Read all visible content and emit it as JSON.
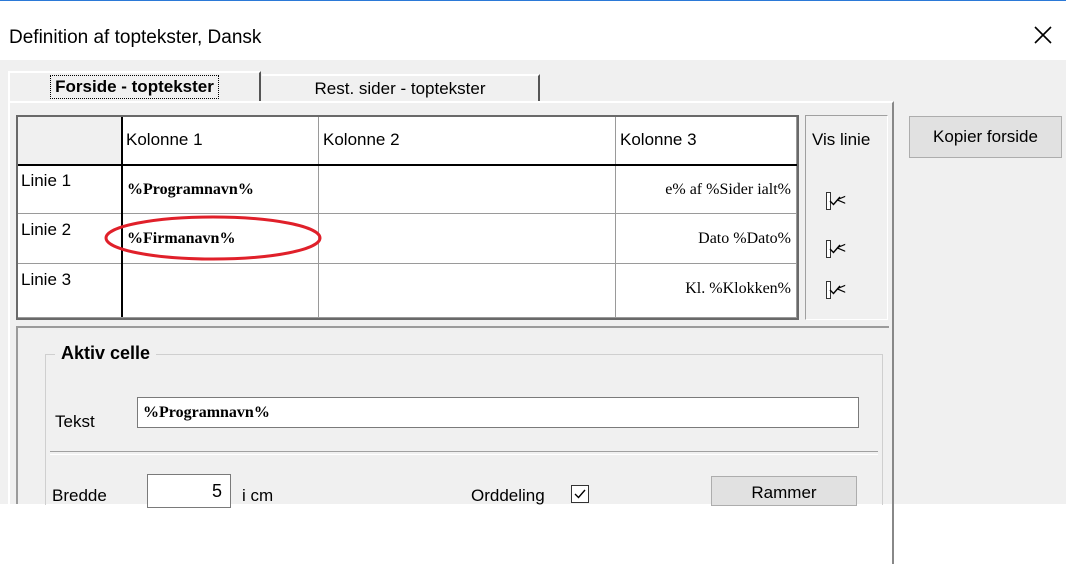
{
  "window": {
    "title": "Definition af toptekster, Dansk"
  },
  "tabs": [
    {
      "label": "Forside - toptekster",
      "active": true
    },
    {
      "label": "Rest. sider - toptekster",
      "active": false
    }
  ],
  "grid": {
    "columns": [
      "Kolonne 1",
      "Kolonne 2",
      "Kolonne 3"
    ],
    "rows": [
      {
        "label": "Linie 1",
        "cells": [
          "%Programnavn%",
          "",
          "e% af  %Sider ialt%"
        ]
      },
      {
        "label": "Linie 2",
        "cells": [
          "%Firmanavn%",
          "",
          "Dato %Dato%"
        ]
      },
      {
        "label": "Linie 3",
        "cells": [
          "",
          "",
          "Kl. %Klokken%"
        ]
      }
    ]
  },
  "vis_linie": {
    "label": "Vis linie",
    "checks": [
      {
        "checked": true,
        "suffix": "<"
      },
      {
        "checked": true,
        "suffix": "<"
      },
      {
        "checked": true,
        "suffix": "<"
      }
    ]
  },
  "buttons": {
    "kopier_forside": "Kopier forside",
    "rammer": "Rammer"
  },
  "aktiv_celle": {
    "title": "Aktiv celle",
    "tekst_label": "Tekst",
    "tekst_value": "%Programnavn%",
    "bredde_label": "Bredde",
    "bredde_value": "5",
    "bredde_unit": "i cm",
    "orddeling_label": "Orddeling",
    "orddeling_checked": true
  },
  "colors": {
    "highlight_ellipse": "#e0202a",
    "titlebar_accent": "#2b79d7"
  },
  "icons": {
    "close": "close-icon",
    "checkmark": "checkmark-icon"
  }
}
